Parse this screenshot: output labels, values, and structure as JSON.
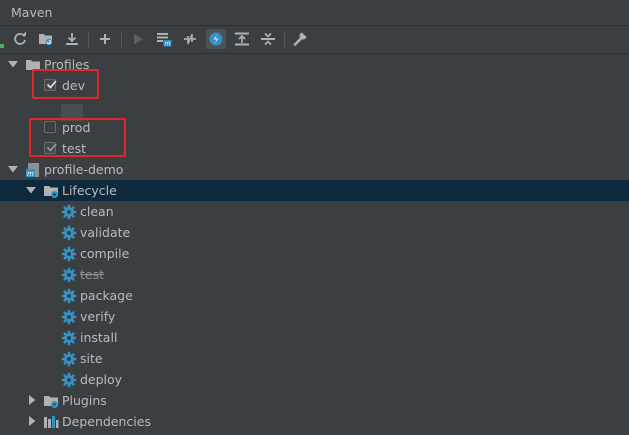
{
  "window": {
    "title": "Maven"
  },
  "toolbar": {
    "buttons": [
      {
        "name": "reimport-icon"
      },
      {
        "name": "generate-sources-icon"
      },
      {
        "name": "download-icon"
      },
      {
        "name": "add-icon"
      },
      {
        "name": "run-icon"
      },
      {
        "name": "execute-goal-icon"
      },
      {
        "name": "toggle-offline-icon"
      },
      {
        "name": "skip-tests-icon"
      },
      {
        "name": "show-dependencies-icon"
      },
      {
        "name": "collapse-all-icon"
      },
      {
        "name": "settings-wrench-icon"
      }
    ]
  },
  "tree": {
    "profiles": {
      "label": "Profiles",
      "items": [
        {
          "label": "dev",
          "checked": true
        },
        {
          "label": "prod",
          "checked": false
        },
        {
          "label": "test",
          "checked": true
        }
      ]
    },
    "project": {
      "label": "profile-demo",
      "lifecycle": {
        "label": "Lifecycle",
        "goals": [
          {
            "label": "clean"
          },
          {
            "label": "validate"
          },
          {
            "label": "compile"
          },
          {
            "label": "test",
            "skipped": true
          },
          {
            "label": "package"
          },
          {
            "label": "verify"
          },
          {
            "label": "install"
          },
          {
            "label": "site"
          },
          {
            "label": "deploy"
          }
        ]
      },
      "plugins": {
        "label": "Plugins"
      },
      "dependencies": {
        "label": "Dependencies"
      }
    }
  },
  "colors": {
    "background": "#3c3f41",
    "selection": "#0d293e",
    "highlight_box": "#e0282b",
    "gear": "#3592c4",
    "accent": "#3592c4"
  }
}
